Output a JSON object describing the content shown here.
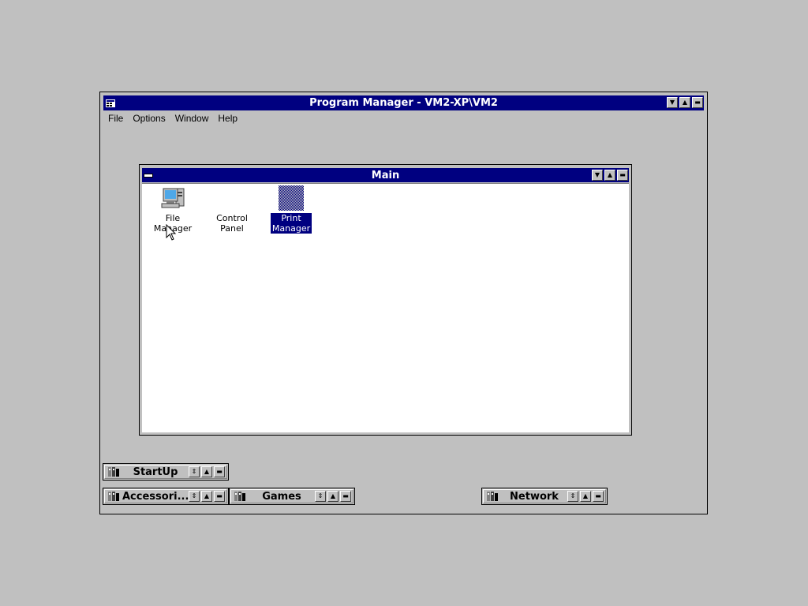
{
  "program_manager": {
    "title": "Program Manager - VM2-XP\\VM2",
    "menu": [
      "File",
      "Options",
      "Window",
      "Help"
    ]
  },
  "main_group": {
    "title": "Main",
    "icons": [
      {
        "label_line1": "File",
        "label_line2": "Manager",
        "icon": "file-manager-icon",
        "selected": false
      },
      {
        "label_line1": "Control",
        "label_line2": "Panel",
        "icon": "control-panel-icon",
        "selected": false
      },
      {
        "label_line1": "Print",
        "label_line2": "Manager",
        "icon": "print-manager-icon",
        "selected": true
      }
    ]
  },
  "minimized_groups": [
    {
      "label": "StartUp"
    },
    {
      "label": "Accessori..."
    },
    {
      "label": "Games"
    },
    {
      "label": "Network"
    }
  ],
  "colors": {
    "desktop": "#c0c0c0",
    "titlebar_active": "#000080",
    "selection": "#000080"
  }
}
